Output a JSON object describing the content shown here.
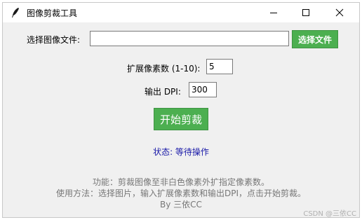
{
  "window": {
    "title": "图像剪裁工具",
    "icons": {
      "app": "feather-icon",
      "minimize": "minimize-icon",
      "maximize": "maximize-icon",
      "close": "close-icon"
    }
  },
  "file_row": {
    "label": "选择图像文件:",
    "value": "",
    "button_label": "选择文件"
  },
  "expand_row": {
    "label": "扩展像素数 (1-10):",
    "value": "5"
  },
  "dpi_row": {
    "label": "输出 DPI:",
    "value": "300"
  },
  "start_button": {
    "label": "开始剪裁"
  },
  "status": "状态: 等待操作",
  "info": {
    "line1": "功能：剪裁图像至非白色像素外扩指定像素数。",
    "line2": "使用方法：选择图片，输入扩展像素数和输出DPI，点击开始剪裁。",
    "line3": "By 三依CC"
  },
  "watermark": "CSDN @三依CC",
  "colors": {
    "accent_green": "#4caf50",
    "status_blue": "#1a1aa8",
    "info_gray": "#777777",
    "background": "#f0f0f0"
  }
}
